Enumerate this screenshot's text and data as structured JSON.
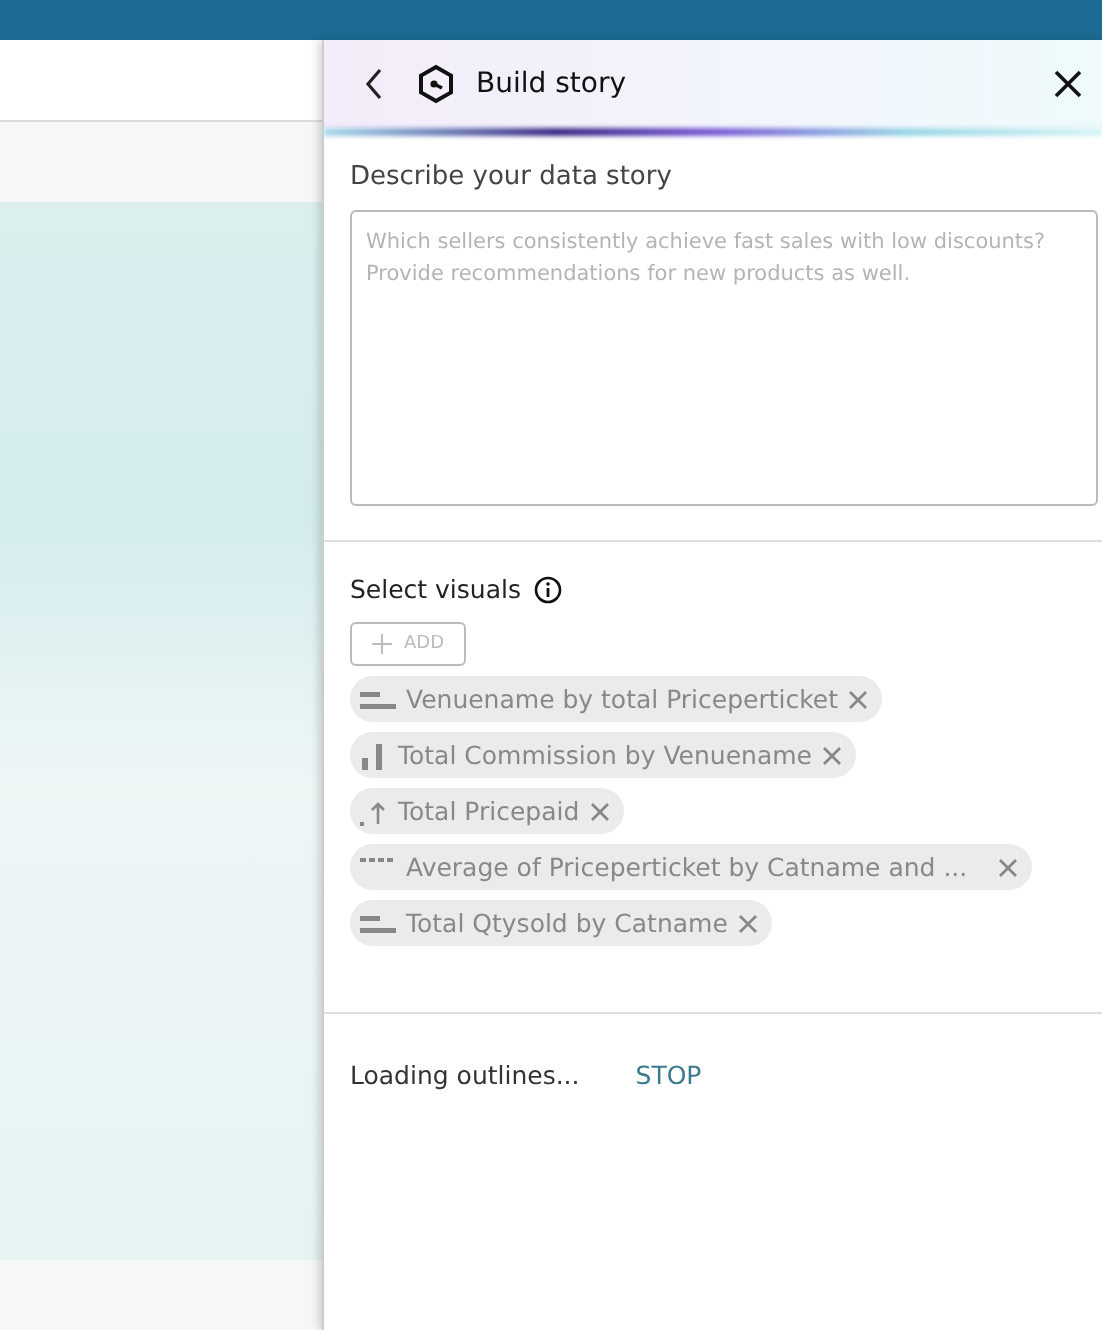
{
  "panel": {
    "title": "Build story"
  },
  "description": {
    "label": "Describe your data story",
    "placeholder": "Which sellers consistently achieve fast sales with low discounts? Provide recommendations for new products as well."
  },
  "visuals": {
    "label": "Select visuals",
    "add_button": {
      "label": "ADD",
      "disabled": true
    },
    "items": [
      {
        "kind": "hbar",
        "label": "Venuename by total Priceperticket"
      },
      {
        "kind": "vbar",
        "label": "Total Commission by Venuename"
      },
      {
        "kind": "kpi",
        "label": "Total Pricepaid"
      },
      {
        "kind": "table",
        "label": "Average of Priceperticket by Catname and ..."
      },
      {
        "kind": "hbar",
        "label": "Total Qtysold by Catname"
      }
    ]
  },
  "status": {
    "text": "Loading outlines...",
    "action": "STOP"
  }
}
